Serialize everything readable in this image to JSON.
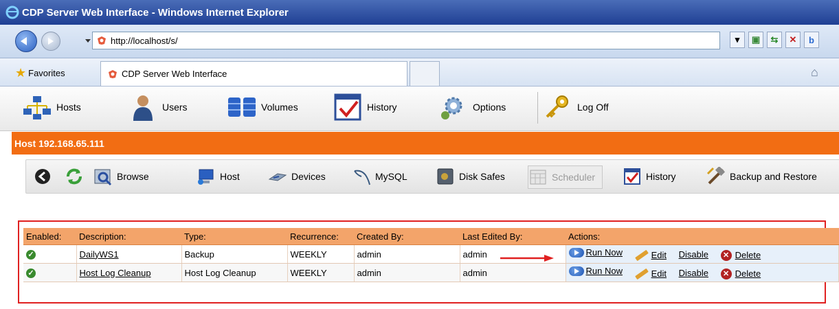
{
  "window": {
    "title": "CDP Server Web Interface - Windows Internet Explorer"
  },
  "browser": {
    "address": "http://localhost/s/",
    "favorites_label": "Favorites",
    "tab_title": "CDP Server Web Interface"
  },
  "app_toolbar": {
    "items": [
      {
        "label": "Hosts",
        "icon": "hosts-icon"
      },
      {
        "label": "Users",
        "icon": "users-icon"
      },
      {
        "label": "Volumes",
        "icon": "volumes-icon"
      },
      {
        "label": "History",
        "icon": "history-icon"
      },
      {
        "label": "Options",
        "icon": "options-icon"
      },
      {
        "label": "Log Off",
        "icon": "logoff-icon"
      }
    ]
  },
  "host": {
    "title": "Host 192.168.65.111"
  },
  "host_toolbar": {
    "items": [
      {
        "label": "Browse"
      },
      {
        "label": "Host"
      },
      {
        "label": "Devices"
      },
      {
        "label": "MySQL"
      },
      {
        "label": "Disk Safes"
      },
      {
        "label": "Scheduler"
      },
      {
        "label": "History"
      },
      {
        "label": "Backup and Restore"
      }
    ]
  },
  "table": {
    "headers": [
      "Enabled:",
      "Description:",
      "Type:",
      "Recurrence:",
      "Created By:",
      "Last Edited By:",
      "Actions:"
    ],
    "rows": [
      {
        "description": "DailyWS1",
        "type": "Backup",
        "recurrence": "WEEKLY",
        "created_by": "admin",
        "last_edited_by": "admin"
      },
      {
        "description": "Host Log Cleanup",
        "type": "Host Log Cleanup",
        "recurrence": "WEEKLY",
        "created_by": "admin",
        "last_edited_by": "admin"
      }
    ],
    "actions": {
      "run_now": "Run Now",
      "edit": "Edit",
      "disable": "Disable",
      "delete": "Delete"
    }
  },
  "colors": {
    "accent_orange": "#f26d13",
    "header_orange": "#f3a46a",
    "highlight_red": "#e02020"
  }
}
